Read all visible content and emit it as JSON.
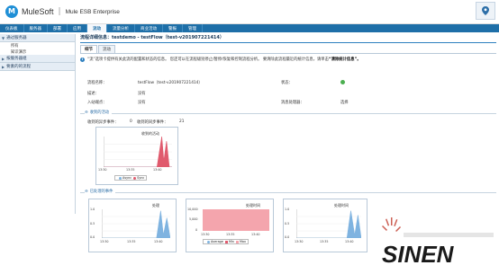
{
  "header": {
    "brand": "MuleSoft",
    "brand_mark": "M",
    "product": "Mule ESB Enterprise"
  },
  "nav": [
    "仪表板",
    "服务器",
    "部署",
    "应用",
    "流动",
    "流量分析",
    "商业活动",
    "警报",
    "管理"
  ],
  "nav_active_index": 4,
  "sidebar": [
    {
      "label": "通过服务器",
      "children": [
        "所有",
        "知识演示"
      ]
    },
    {
      "label": "按服务器组",
      "children": []
    },
    {
      "label": "要素的的流程",
      "children": []
    }
  ],
  "page": {
    "title": "流程详细信息：testdemo - testFlow（test-v201907221414）",
    "tabs": [
      "细节",
      "流动"
    ],
    "info_text": "“流”选项卡提供有关此流的配置和状态的信息。 您还可以在流程级别停止/暂停/恢复和控制流程分析。 要清除此流程最近的统计信息，请单击",
    "info_action": "“清除统计信息”。"
  },
  "details": {
    "flow_name_label": "流程名称：",
    "flow_name_value": "testFlow（test-v201907221414）",
    "status_label": "状态：",
    "desc_label": "描述：",
    "desc_value": "没有",
    "entry_label": "入站端点：",
    "entry_value": "没有",
    "processor_label": "消息处理器：",
    "processor_value": "选择"
  },
  "received": {
    "section": "收到的活动",
    "async_label": "收到的异步事件：",
    "async_value": "0",
    "sync_label": "收到的同步事件：",
    "sync_value": "21"
  },
  "processed_section": "已处理的事件",
  "colors": {
    "nav": "#1e6fa8",
    "accent": "#2d7fbf",
    "sync": "#e05a6d",
    "async": "#7fb3e0",
    "status_ok": "#4caf50"
  },
  "chart_data": [
    {
      "type": "area",
      "title": "收到的活动",
      "x_ticks": [
        "13:30",
        "13:35",
        "13:40"
      ],
      "series": [
        {
          "name": "Async",
          "color": "#7fb3e0",
          "points": [
            [
              0,
              0
            ],
            [
              0.9,
              0
            ],
            [
              1,
              0
            ]
          ]
        },
        {
          "name": "Sync",
          "color": "#e05a6d",
          "points": [
            [
              0,
              0
            ],
            [
              0.78,
              0
            ],
            [
              0.85,
              1
            ],
            [
              0.88,
              0.2
            ],
            [
              0.92,
              0.85
            ],
            [
              0.96,
              0
            ],
            [
              1,
              0
            ]
          ]
        }
      ]
    },
    {
      "type": "area",
      "title": "处理",
      "x_ticks": [
        "13:30",
        "13:35",
        "13:40"
      ],
      "y_ticks": [
        "1.0",
        "0.5",
        "0.0"
      ],
      "series": [
        {
          "name": "",
          "color": "#7fb3e0",
          "points": [
            [
              0,
              0
            ],
            [
              0.8,
              0
            ],
            [
              0.86,
              0.95
            ],
            [
              0.9,
              0.1
            ],
            [
              0.95,
              0.7
            ],
            [
              1,
              0
            ]
          ]
        }
      ]
    },
    {
      "type": "area",
      "title": "处理时间",
      "x_ticks": [
        "13:30",
        "13:35",
        "13:40"
      ],
      "y_ticks": [
        "10,000",
        "5,000",
        "0"
      ],
      "legend": [
        "Average",
        "Min",
        "Max"
      ],
      "series": [
        {
          "name": "Max",
          "color": "#f4a5ad",
          "points": [
            [
              0,
              1
            ],
            [
              1,
              1
            ]
          ]
        }
      ]
    },
    {
      "type": "area",
      "title": "处理时间",
      "x_ticks": [
        "13:30",
        "13:35",
        "13:40"
      ],
      "y_ticks": [
        "1.0",
        "0.5",
        "0.0"
      ],
      "series": [
        {
          "name": "",
          "color": "#7fb3e0",
          "points": [
            [
              0,
              0
            ],
            [
              0.78,
              0
            ],
            [
              0.84,
              0.95
            ],
            [
              0.9,
              0.1
            ],
            [
              0.95,
              0.8
            ],
            [
              1,
              0
            ]
          ]
        }
      ]
    }
  ],
  "watermark": "SINEN"
}
